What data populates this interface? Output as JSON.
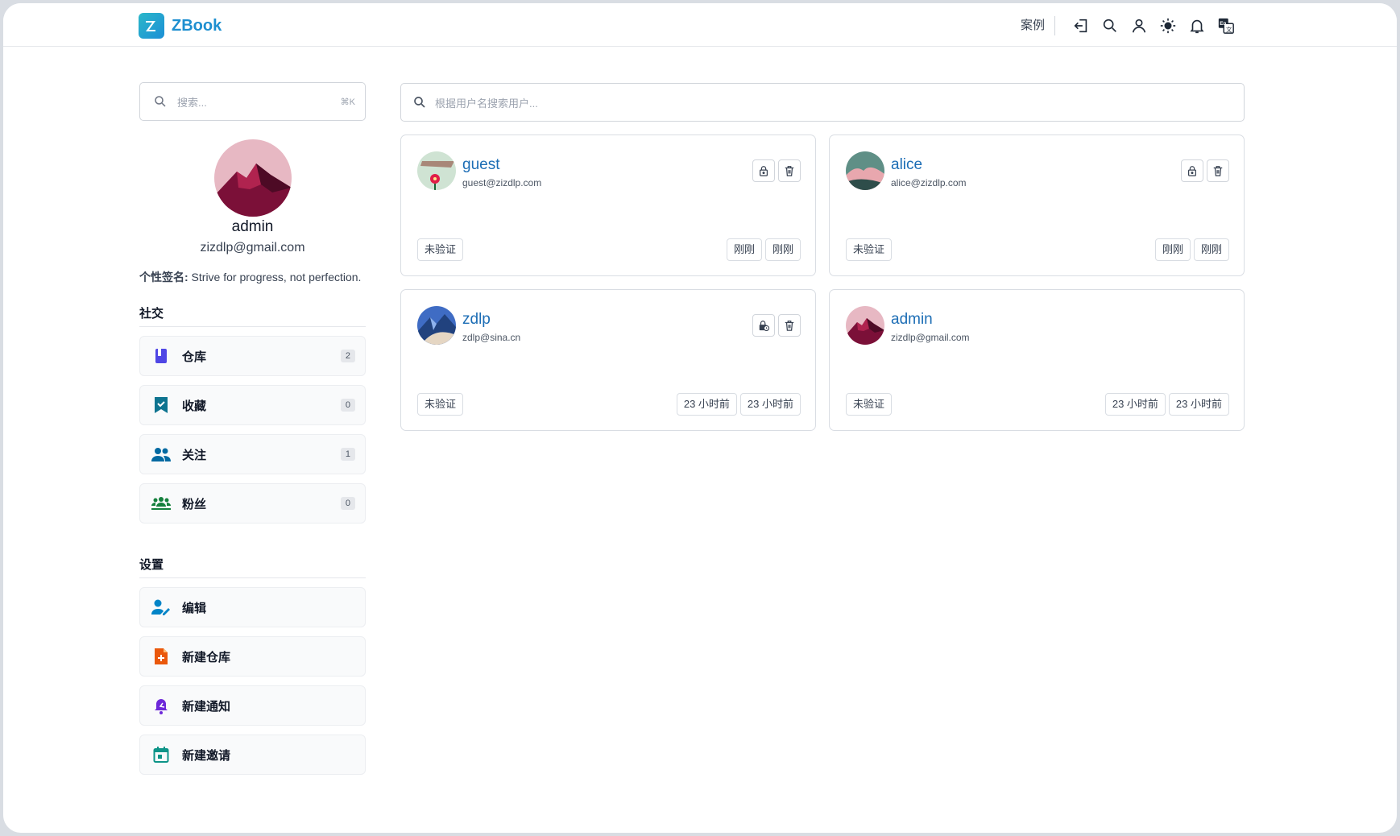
{
  "header": {
    "brand": "ZBook",
    "nav_link": "案例",
    "icons": [
      "logout-icon",
      "search-icon",
      "user-icon",
      "theme-sun-icon",
      "bell-icon",
      "translate-icon"
    ]
  },
  "sidebar": {
    "search_placeholder": "搜索...",
    "search_shortcut": "⌘K",
    "profile": {
      "username": "admin",
      "email": "zizdlp@gmail.com",
      "bio_label": "个性签名:",
      "bio_text": " Strive for progress, not perfection."
    },
    "social_title": "社交",
    "social_items": [
      {
        "label": "仓库",
        "count": "2",
        "icon": "book-icon",
        "color": "#4f46e5"
      },
      {
        "label": "收藏",
        "count": "0",
        "icon": "bookmark-icon",
        "color": "#0e7490"
      },
      {
        "label": "关注",
        "count": "1",
        "icon": "users-icon",
        "color": "#0369a1"
      },
      {
        "label": "粉丝",
        "count": "0",
        "icon": "group-icon",
        "color": "#15803d"
      }
    ],
    "settings_title": "设置",
    "settings_items": [
      {
        "label": "编辑",
        "icon": "user-edit-icon",
        "color": "#0284c7"
      },
      {
        "label": "新建仓库",
        "icon": "file-plus-icon",
        "color": "#ea580c"
      },
      {
        "label": "新建通知",
        "icon": "notify-icon",
        "color": "#6d28d9"
      },
      {
        "label": "新建邀请",
        "icon": "calendar-icon",
        "color": "#0d9488"
      }
    ]
  },
  "main": {
    "search_placeholder": "根据用户名搜索用户...",
    "users": [
      {
        "name": "guest",
        "email": "guest@zizdlp.com",
        "status": "未验证",
        "created": "刚刚",
        "updated": "刚刚",
        "lock_icon": "lock-icon"
      },
      {
        "name": "alice",
        "email": "alice@zizdlp.com",
        "status": "未验证",
        "created": "刚刚",
        "updated": "刚刚",
        "lock_icon": "lock-icon"
      },
      {
        "name": "zdlp",
        "email": "zdlp@sina.cn",
        "status": "未验证",
        "created": "23 小时前",
        "updated": "23 小时前",
        "lock_icon": "lock-clock-icon"
      },
      {
        "name": "admin",
        "email": "zizdlp@gmail.com",
        "status": "未验证",
        "created": "23 小时前",
        "updated": "23 小时前"
      }
    ]
  }
}
